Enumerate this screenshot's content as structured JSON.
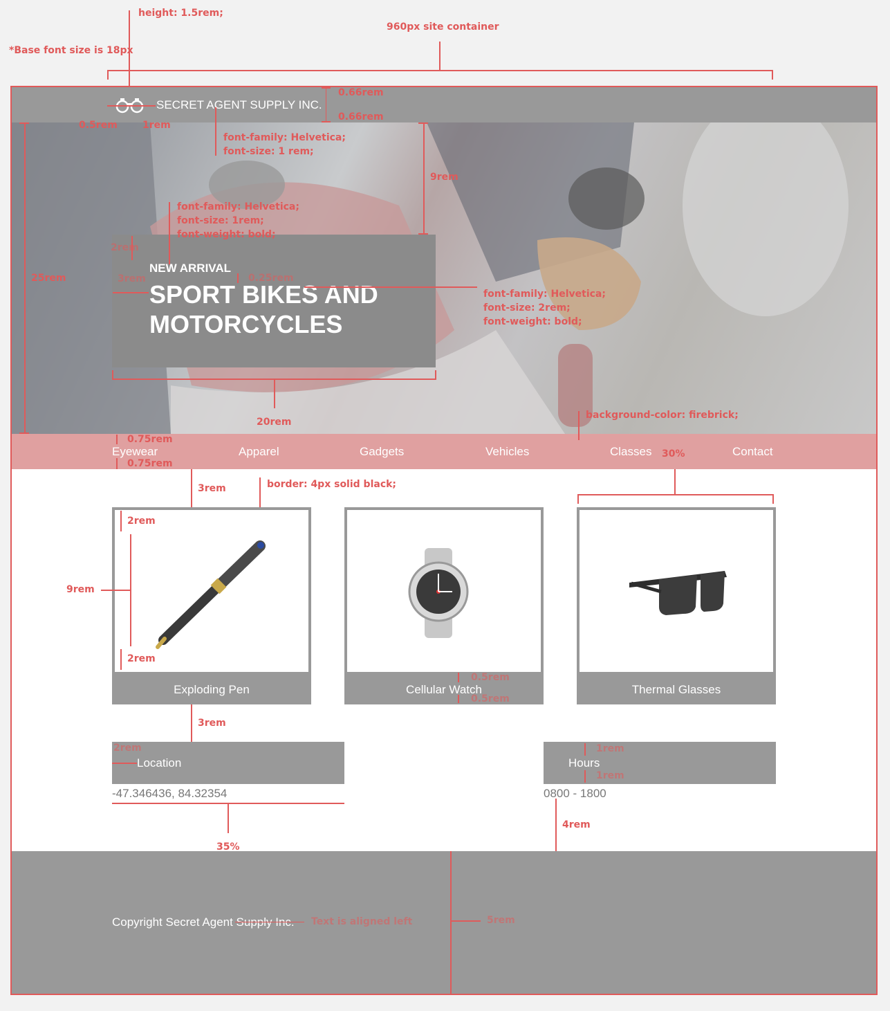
{
  "annotations": {
    "height": "height: 1.5rem;",
    "container": "960px site container",
    "base_font": "*Base font size is 18px",
    "pad_top": "0.66rem",
    "pad_bottom": "0.66rem",
    "logo_left": "0.5rem",
    "logo_gap": "1rem",
    "title_font": "font-family: Helvetica;",
    "title_size": "font-size: 1 rem;",
    "hero_height": "25rem",
    "hero_top": "9rem",
    "eyebrow_font": "font-family: Helvetica;",
    "eyebrow_size": "font-size: 1rem;",
    "eyebrow_weight": "font-weight: bold;",
    "box_pad_top": "2rem",
    "box_pad_left": "3rem",
    "eyebrow_gap": "0.25rem",
    "headline_font": "font-family: Helvetica;",
    "headline_size": "font-size: 2rem;",
    "headline_weight": "font-weight: bold;",
    "box_width": "20rem",
    "nav_bg": "background-color: firebrick;",
    "nav_pad_top": "0.75rem",
    "nav_pad_bottom": "0.75rem",
    "card_width": "30%",
    "cards_top": "3rem",
    "card_border": "border: 4px solid black;",
    "img_pad_top": "2rem",
    "img_height": "9rem",
    "img_pad_bottom": "2rem",
    "label_pad_top": "0.5rem",
    "label_pad_bottom": "0.5rem",
    "info_top": "3rem",
    "info_pad_left": "2rem",
    "hours_pad_top": "1rem",
    "hours_pad_bottom": "1rem",
    "info_width": "35%",
    "footer_gap": "4rem",
    "footer_pad": "5rem",
    "footer_note": "Text is aligned left"
  },
  "header": {
    "title": "SECRET AGENT SUPPLY INC."
  },
  "hero": {
    "eyebrow": "NEW ARRIVAL",
    "headline": "SPORT BIKES AND MOTORCYCLES"
  },
  "nav": {
    "items": [
      "Eyewear",
      "Apparel",
      "Gadgets",
      "Vehicles",
      "Classes",
      "Contact"
    ]
  },
  "products": [
    {
      "name": "Exploding Pen",
      "icon": "pen-icon"
    },
    {
      "name": "Cellular Watch",
      "icon": "watch-icon"
    },
    {
      "name": "Thermal Glasses",
      "icon": "glasses-icon"
    }
  ],
  "location": {
    "title": "Location",
    "value": "-47.346436, 84.32354"
  },
  "hours": {
    "title": "Hours",
    "value": "0800 - 1800"
  },
  "footer": {
    "copyright": "Copyright Secret Agent Supply Inc."
  },
  "colors": {
    "accent": "#e05a5a",
    "nav_bg": "#e0a0a0",
    "block": "#999999"
  }
}
